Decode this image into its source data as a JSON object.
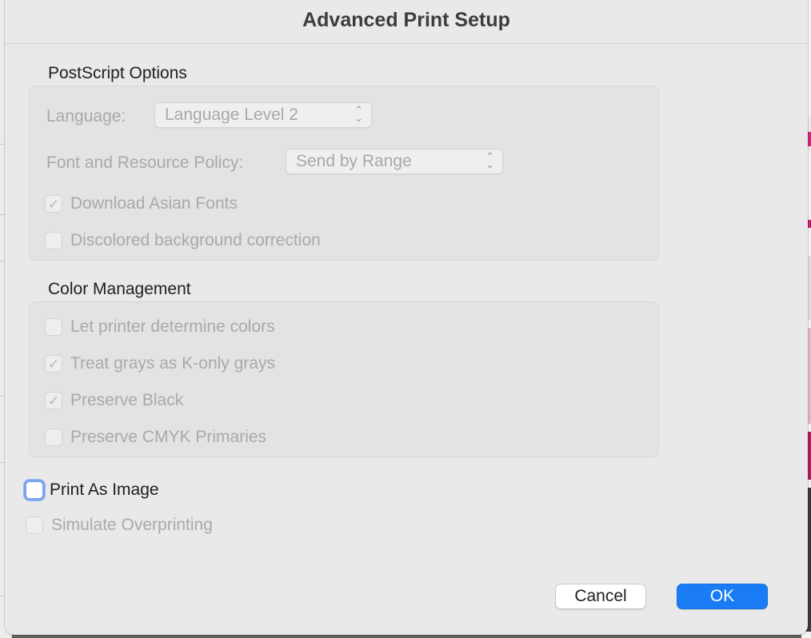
{
  "dialog": {
    "title": "Advanced Print Setup"
  },
  "postscript": {
    "section_title": "PostScript Options",
    "language_label": "Language:",
    "language_value": "Language Level 2",
    "font_policy_label": "Font and Resource Policy:",
    "font_policy_value": "Send by Range",
    "download_asian_fonts": {
      "label": "Download Asian Fonts",
      "checked": true,
      "enabled": false
    },
    "discolored_bg": {
      "label": "Discolored background correction",
      "checked": false,
      "enabled": false
    }
  },
  "color_management": {
    "section_title": "Color Management",
    "let_printer": {
      "label": "Let printer determine colors",
      "checked": false,
      "enabled": false
    },
    "treat_grays": {
      "label": "Treat grays as K-only grays",
      "checked": true,
      "enabled": false
    },
    "preserve_black": {
      "label": "Preserve Black",
      "checked": true,
      "enabled": false
    },
    "preserve_cmyk": {
      "label": "Preserve CMYK Primaries",
      "checked": false,
      "enabled": false
    }
  },
  "print_as_image": {
    "label": "Print As Image",
    "checked": false,
    "enabled": true,
    "focused": true
  },
  "simulate_overprinting": {
    "label": "Simulate Overprinting",
    "checked": false,
    "enabled": false
  },
  "buttons": {
    "cancel": "Cancel",
    "ok": "OK"
  },
  "colors": {
    "accent": "#1a7cf5",
    "focus_ring": "#7ca3ee",
    "dialog_bg": "#e9e9e9"
  },
  "icons": {
    "checkmark": "checkmark-icon",
    "popup_arrows": "up-down-chevron-icon"
  }
}
